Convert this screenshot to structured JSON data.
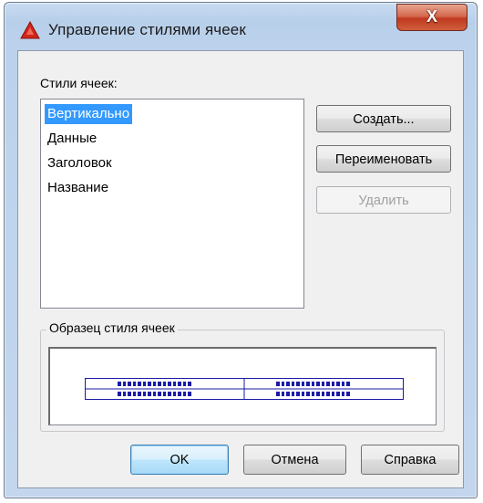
{
  "window": {
    "title": "Управление стилями ячеек",
    "close_glyph": "X"
  },
  "styles_label": "Стили ячеек:",
  "styles": [
    {
      "label": "Вертикально",
      "selected": true
    },
    {
      "label": "Данные",
      "selected": false
    },
    {
      "label": "Заголовок",
      "selected": false
    },
    {
      "label": "Название",
      "selected": false
    }
  ],
  "side_buttons": {
    "create": "Создать...",
    "rename": "Переименовать",
    "delete": "Удалить"
  },
  "preview_group": {
    "label": "Образец стиля ячеек"
  },
  "bottom_buttons": {
    "ok": "OK",
    "cancel": "Отмена",
    "help": "Справка"
  },
  "colors": {
    "selection": "#3399ff",
    "preview_grid": "#1a1aa6",
    "close_button": "#c0391f",
    "app_icon": "#d0261b"
  },
  "icons": {
    "app": "autocad-logo-icon",
    "close": "close-icon"
  }
}
